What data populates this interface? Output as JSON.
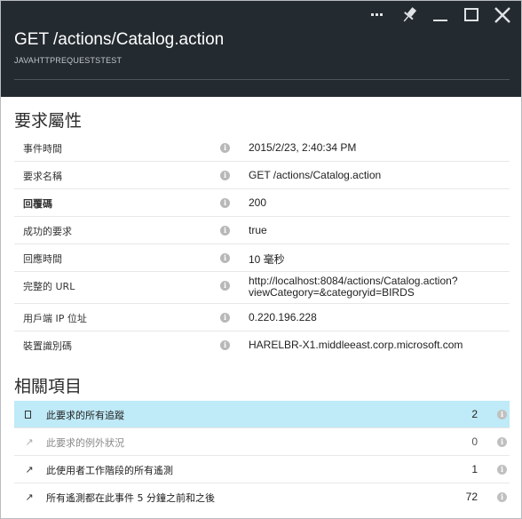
{
  "header": {
    "title": "GET /actions/Catalog.action",
    "subtitle": "JAVAHTTPREQUESTSTEST",
    "icons": [
      "more-icon",
      "pin-icon",
      "minimize-icon",
      "maximize-icon",
      "close-icon"
    ]
  },
  "request_properties": {
    "heading": "要求屬性",
    "rows": [
      {
        "label": "事件時間",
        "value": "2015/2/23, 2:40:34 PM"
      },
      {
        "label": "要求名稱",
        "value": "GET /actions/Catalog.action"
      },
      {
        "label": "回覆碼",
        "value": "200"
      },
      {
        "label": "成功的要求",
        "value": "true"
      },
      {
        "label": "回應時間",
        "value": "10 毫秒"
      },
      {
        "label": "完整的 URL",
        "value_line1": "http://localhost:8084/actions/Catalog.action?",
        "value_line2": "viewCategory=&categoryid=BIRDS"
      },
      {
        "label": "用戶端 IP 位址",
        "value": "0.220.196.228"
      },
      {
        "label": "裝置識別碼",
        "value": "HARELBR-X1.middleeast.corp.microsoft.com"
      }
    ]
  },
  "related_items": {
    "heading": "相關項目",
    "rows": [
      {
        "label": "此要求的所有追蹤",
        "count": "2",
        "icon": "trace-document-icon",
        "selected": true
      },
      {
        "label": "此要求的例外狀況",
        "count": "0",
        "icon": "arrow-icon",
        "disabled": true
      },
      {
        "label": "此使用者工作階段的所有遙測",
        "count": "1",
        "icon": "arrow-icon"
      },
      {
        "label": "所有遙測都在此事件 5 分鐘之前和之後",
        "count": "72",
        "icon": "arrow-icon"
      }
    ]
  },
  "colors": {
    "header_bg": "#232a30",
    "selected_row": "#bfeaf7",
    "info_icon": "#b8b8b8"
  }
}
